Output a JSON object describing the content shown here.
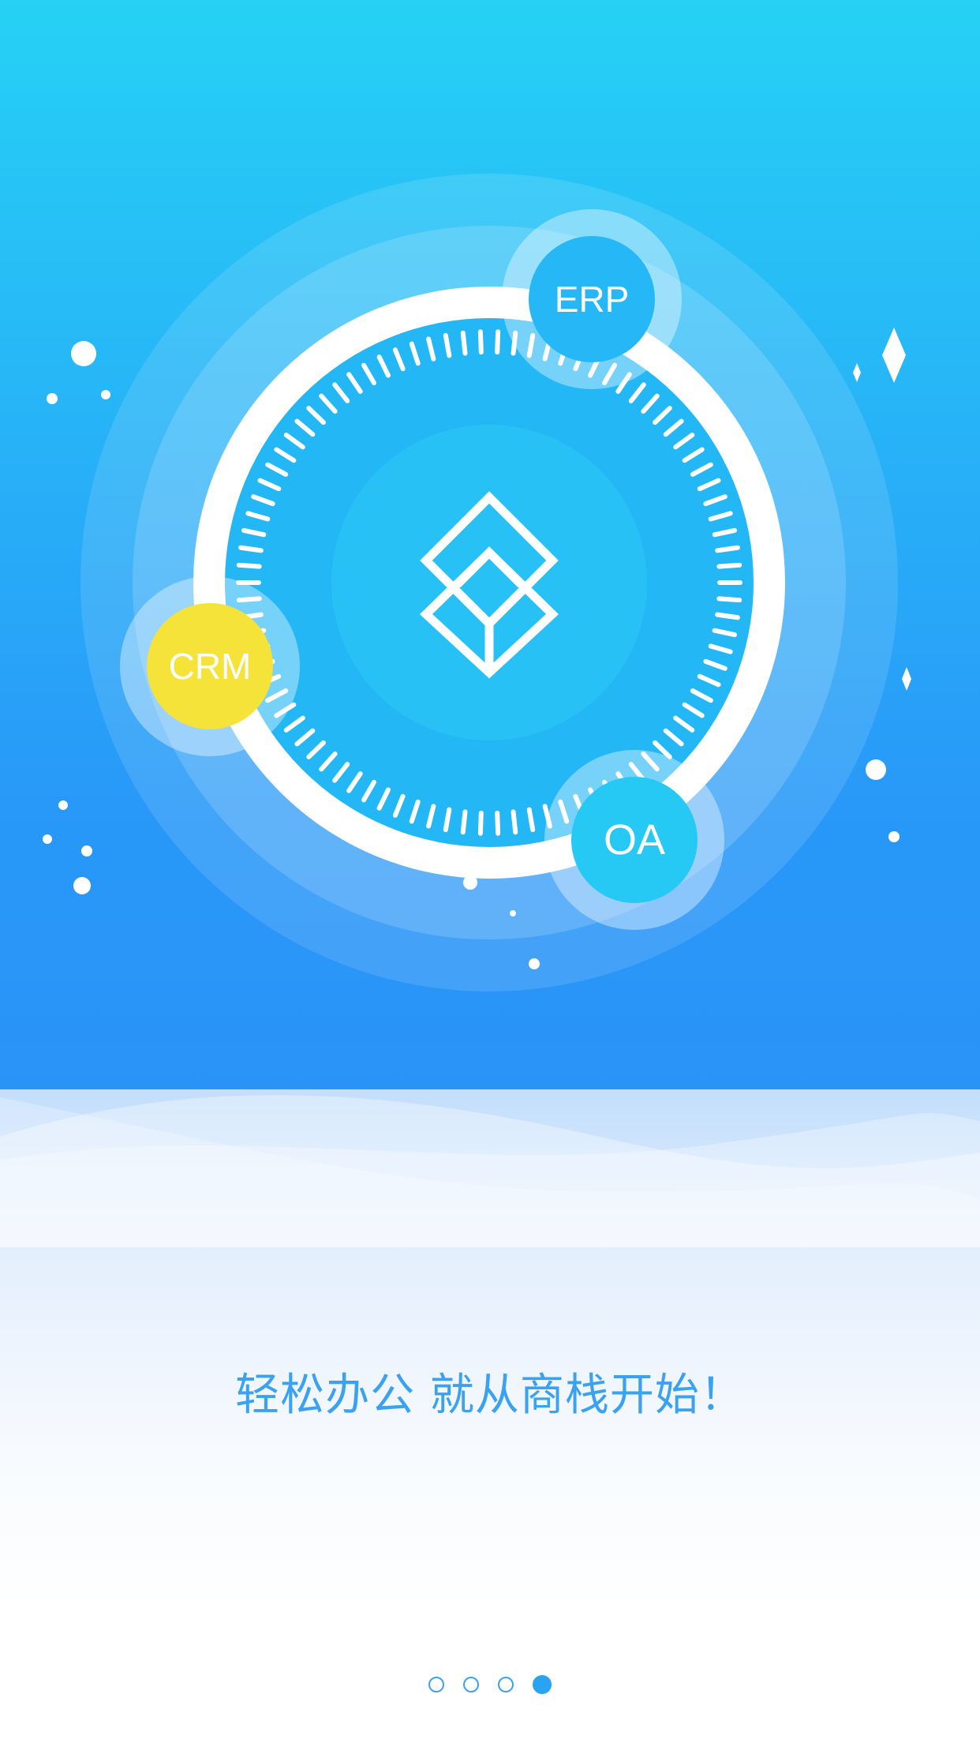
{
  "modules": {
    "erp": {
      "label": "ERP",
      "color": "#26b8f6"
    },
    "crm": {
      "label": "CRM",
      "color": "#f6e33a"
    },
    "oa": {
      "label": "OA",
      "color": "#26c8f4"
    }
  },
  "logo": {
    "icon": "stacked-diamond-logo-icon"
  },
  "tagline": "轻松办公  就从商栈开始！",
  "pager": {
    "total": 4,
    "current": 4
  },
  "colors": {
    "sky_top": "#26d1f5",
    "sky_bottom": "#2a92f8",
    "accent_text": "#3aa2f1",
    "crm_yellow": "#f6e33a"
  }
}
